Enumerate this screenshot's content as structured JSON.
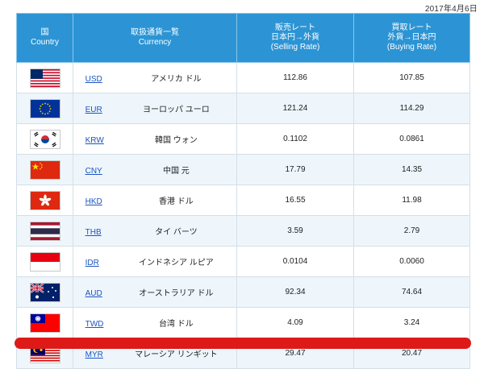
{
  "date": "2017年4月6日",
  "header": {
    "country": [
      "国",
      "Country"
    ],
    "currency": [
      "取扱通貨一覧",
      "Currency"
    ],
    "selling": [
      "販売レート",
      "日本円→外貨",
      "(Selling Rate)"
    ],
    "buying": [
      "買取レート",
      "外貨→日本円",
      "(Buying Rate)"
    ]
  },
  "rows": [
    {
      "flag": "usa-flag-icon",
      "code": "USD",
      "name": "アメリカ ドル",
      "selling": "112.86",
      "buying": "107.85"
    },
    {
      "flag": "eu-flag-icon",
      "code": "EUR",
      "name": "ヨーロッパ ユーロ",
      "selling": "121.24",
      "buying": "114.29"
    },
    {
      "flag": "korea-flag-icon",
      "code": "KRW",
      "name": "韓国 ウォン",
      "selling": "0.1102",
      "buying": "0.0861"
    },
    {
      "flag": "china-flag-icon",
      "code": "CNY",
      "name": "中国 元",
      "selling": "17.79",
      "buying": "14.35"
    },
    {
      "flag": "hongkong-flag-icon",
      "code": "HKD",
      "name": "香港 ドル",
      "selling": "16.55",
      "buying": "11.98"
    },
    {
      "flag": "thailand-flag-icon",
      "code": "THB",
      "name": "タイ バーツ",
      "selling": "3.59",
      "buying": "2.79"
    },
    {
      "flag": "indonesia-flag-icon",
      "code": "IDR",
      "name": "インドネシア ルピア",
      "selling": "0.0104",
      "buying": "0.0060"
    },
    {
      "flag": "australia-flag-icon",
      "code": "AUD",
      "name": "オーストラリア ドル",
      "selling": "92.34",
      "buying": "74.64"
    },
    {
      "flag": "taiwan-flag-icon",
      "code": "TWD",
      "name": "台湾 ドル",
      "selling": "4.09",
      "buying": "3.24"
    },
    {
      "flag": "malaysia-flag-icon",
      "code": "MYR",
      "name": "マレーシア リンギット",
      "selling": "29.47",
      "buying": "20.47"
    }
  ],
  "colors": {
    "header_bg": "#2c94d4",
    "stripe_bg": "#eef6fc",
    "link": "#1b55c0",
    "strike": "#dd1a18"
  }
}
